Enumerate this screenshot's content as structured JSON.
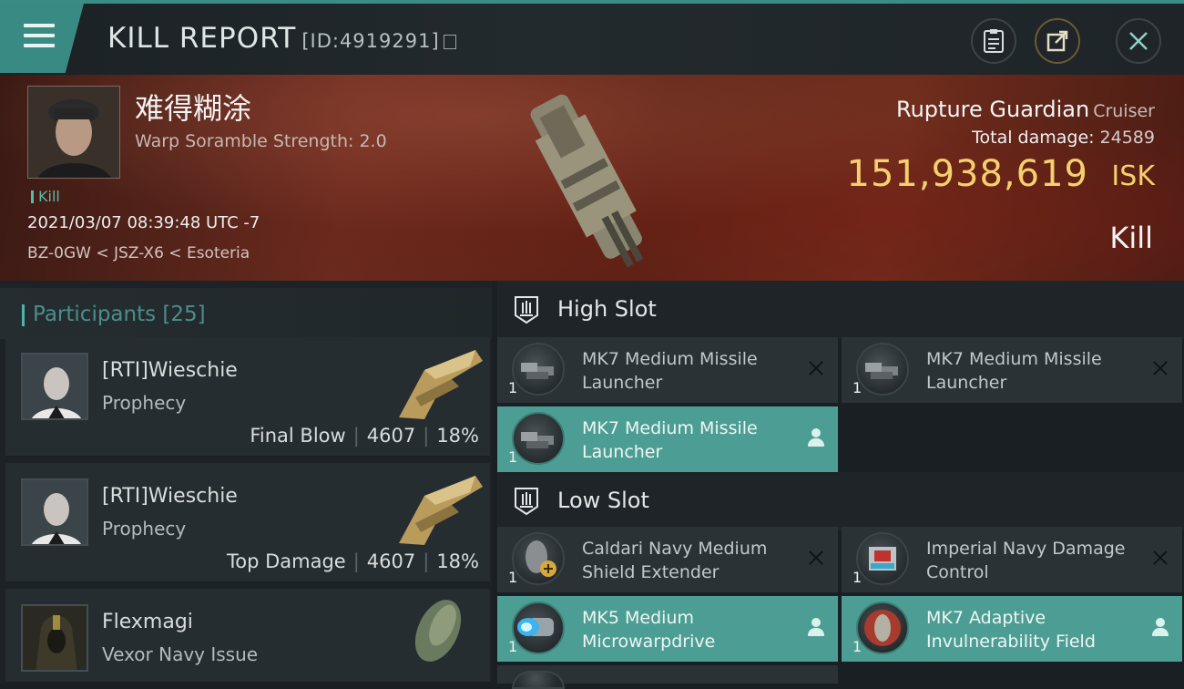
{
  "header": {
    "title": "KILL REPORT",
    "id_label": "[ID:4919291]"
  },
  "victim": {
    "name": "难得糊涂",
    "warp_scramble": "Warp Soramble Strength: 2.0",
    "tag": "Kill",
    "timestamp": "2021/03/07 08:39:48 UTC -7",
    "location": "BZ-0GW < JSZ-X6 < Esoteria",
    "ship_name": "Rupture Guardian",
    "ship_class": "Cruiser",
    "total_damage_label": "Total damage:",
    "total_damage_value": "24589",
    "isk_value": "151,938,619",
    "isk_unit": "ISK",
    "result": "Kill"
  },
  "participants": {
    "title": "Participants",
    "count": "[25]",
    "items": [
      {
        "name": "[RTI]Wieschie",
        "ship": "Prophecy",
        "role": "Final Blow",
        "damage": "4607",
        "percent": "18%"
      },
      {
        "name": "[RTI]Wieschie",
        "ship": "Prophecy",
        "role": "Top Damage",
        "damage": "4607",
        "percent": "18%"
      },
      {
        "name": "Flexmagi",
        "ship": "Vexor Navy Issue",
        "role": "",
        "damage": "",
        "percent": ""
      }
    ]
  },
  "slots": {
    "high": {
      "label": "High Slot",
      "modules": [
        {
          "name": "MK7 Medium Missile Launcher",
          "qty": "1",
          "icon": "missile-launcher-icon",
          "flag": "destroyed"
        },
        {
          "name": "MK7 Medium Missile Launcher",
          "qty": "1",
          "icon": "missile-launcher-icon",
          "flag": "destroyed"
        },
        {
          "name": "MK7 Medium Missile Launcher",
          "qty": "1",
          "icon": "missile-launcher-icon",
          "flag": "dropped"
        }
      ]
    },
    "low": {
      "label": "Low Slot",
      "modules": [
        {
          "name": "Caldari Navy Medium Shield Extender",
          "qty": "1",
          "icon": "shield-extender-icon",
          "flag": "destroyed"
        },
        {
          "name": "Imperial Navy Damage Control",
          "qty": "1",
          "icon": "damage-control-icon",
          "flag": "destroyed"
        },
        {
          "name": "MK5 Medium Microwarpdrive",
          "qty": "1",
          "icon": "microwarpdrive-icon",
          "flag": "dropped"
        },
        {
          "name": "MK7 Adaptive Invulnerability Field",
          "qty": "1",
          "icon": "invulnerability-field-icon",
          "flag": "dropped"
        }
      ]
    }
  },
  "colors": {
    "accent_teal": "#3a8a84",
    "isk_gold": "#f5d06d",
    "active_module": "#4c9e94"
  }
}
